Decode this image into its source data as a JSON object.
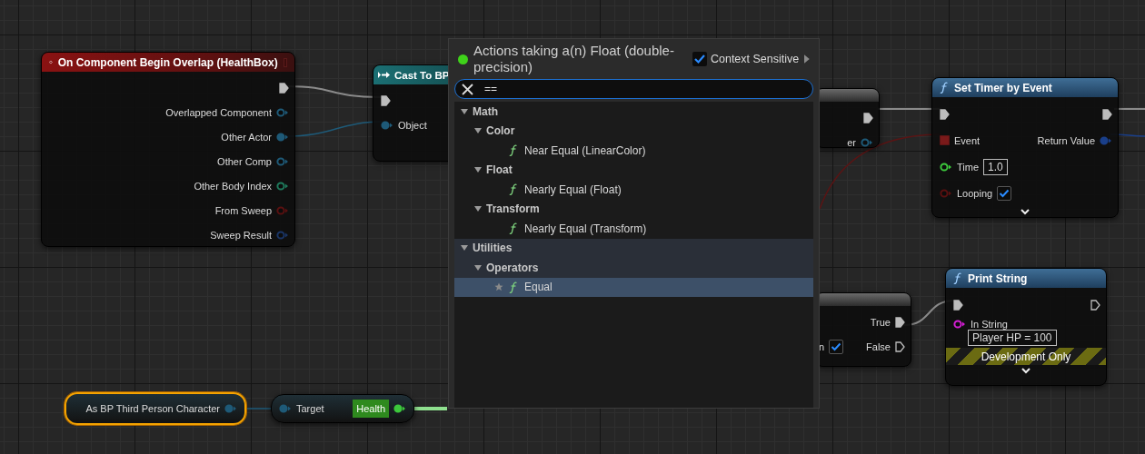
{
  "nodes": [
    {
      "kind": "event",
      "title": "On Component Begin Overlap (HealthBox)",
      "selected": false,
      "rows": [
        {
          "right": {
            "kind": "exec",
            "connected": true
          }
        },
        {
          "right": {
            "kind": "data",
            "label": "Overlapped Component",
            "color": "#1e5a78",
            "connected": false
          }
        },
        {
          "right": {
            "kind": "data",
            "label": "Other Actor",
            "color": "#1e5a78",
            "connected": true
          }
        },
        {
          "right": {
            "kind": "data",
            "label": "Other Comp",
            "color": "#1e5a78",
            "connected": false
          }
        },
        {
          "right": {
            "kind": "data",
            "label": "Other Body Index",
            "color": "#1f7a5c",
            "connected": false
          }
        },
        {
          "right": {
            "kind": "data",
            "label": "From Sweep",
            "color": "#5a1010",
            "connected": false
          }
        },
        {
          "right": {
            "kind": "data",
            "label": "Sweep Result",
            "color": "#1a3566",
            "connected": false
          }
        }
      ]
    },
    {
      "kind": "cast",
      "title": "Cast To BP",
      "selected": false,
      "rows": [
        {
          "left": {
            "kind": "exec",
            "connected": true
          }
        },
        {
          "left": {
            "kind": "data",
            "label": "Object",
            "color": "#1e5a78",
            "connected": true
          }
        }
      ]
    },
    {
      "kind": "plain",
      "selected": false,
      "rows": [
        {
          "right": {
            "kind": "exec",
            "connected": true
          }
        },
        {
          "right": {
            "kind": "data",
            "label": "er",
            "color": "#1e5a78",
            "connected": false
          }
        }
      ]
    },
    {
      "kind": "function",
      "title": "Set Timer by Event",
      "selected": false,
      "advanced": true,
      "rows": [
        {
          "left": {
            "kind": "exec",
            "connected": true
          },
          "right": {
            "kind": "exec",
            "connected": true
          }
        },
        {
          "left": {
            "kind": "delegate",
            "label": "Event",
            "color": "#7a1a1a",
            "connected": true
          },
          "right": {
            "kind": "data",
            "label": "Return Value",
            "color": "#1a3f8a",
            "connected": true
          }
        },
        {
          "left": {
            "kind": "data",
            "label": "Time",
            "color": "#3cc83c",
            "connected": false,
            "value": "1.0"
          }
        },
        {
          "left": {
            "kind": "data",
            "label": "Looping",
            "color": "#5a1010",
            "connected": false,
            "checked": true
          }
        }
      ]
    },
    {
      "kind": "plain",
      "selected": false,
      "rows": [
        {
          "right": {
            "kind": "exec",
            "label": "True",
            "connected": true
          }
        },
        {
          "left": {
            "kind": "bool",
            "label": "n",
            "checked": true
          },
          "right": {
            "kind": "exec",
            "label": "False",
            "connected": false
          }
        }
      ]
    },
    {
      "kind": "function",
      "title": "Print String",
      "selected": false,
      "advanced": true,
      "development_only": "Development Only",
      "rows": [
        {
          "left": {
            "kind": "exec",
            "connected": true
          },
          "right": {
            "kind": "exec",
            "connected": false
          }
        },
        {
          "left": {
            "kind": "data",
            "label": "In String",
            "color": "#d41ed4",
            "connected": false,
            "value": "Player HP = 100"
          }
        }
      ]
    },
    {
      "kind": "compact",
      "selected": true,
      "rows": [
        {
          "right": {
            "kind": "data",
            "label": "As BP Third Person Character",
            "color": "#1e5a78",
            "connected": true
          }
        }
      ]
    },
    {
      "kind": "compact",
      "selected": false,
      "rows": [
        {
          "left": {
            "kind": "data",
            "label": "Target",
            "color": "#1e5a78",
            "connected": true
          },
          "right": {
            "kind": "data",
            "label": "Health",
            "color": "#3cc83c",
            "connected": true,
            "highlighted": true
          }
        }
      ]
    }
  ],
  "action_menu": {
    "title": "Actions taking a(n) Float (double-precision)",
    "context_sensitive": {
      "label": "Context Sensitive",
      "checked": true
    },
    "search": {
      "value": "=="
    },
    "tree": [
      {
        "label": "Math",
        "expanded": true,
        "selected": false,
        "highlighted": false,
        "children": [
          {
            "label": "Color",
            "expanded": true,
            "selected": false,
            "highlighted": false,
            "children": [
              {
                "label": "Near Equal (LinearColor)",
                "selected": false,
                "highlighted": false,
                "favorite": false
              }
            ]
          },
          {
            "label": "Float",
            "expanded": true,
            "selected": false,
            "highlighted": false,
            "children": [
              {
                "label": "Nearly Equal (Float)",
                "selected": false,
                "highlighted": false,
                "favorite": false
              }
            ]
          },
          {
            "label": "Transform",
            "expanded": true,
            "selected": false,
            "highlighted": false,
            "children": [
              {
                "label": "Nearly Equal (Transform)",
                "selected": false,
                "highlighted": false,
                "favorite": false
              }
            ]
          }
        ]
      },
      {
        "label": "Utilities",
        "expanded": true,
        "selected": false,
        "highlighted": true,
        "children": [
          {
            "label": "Operators",
            "expanded": true,
            "selected": false,
            "highlighted": true,
            "children": [
              {
                "label": "Equal",
                "selected": true,
                "highlighted": false,
                "favorite": true
              }
            ]
          }
        ]
      }
    ]
  }
}
